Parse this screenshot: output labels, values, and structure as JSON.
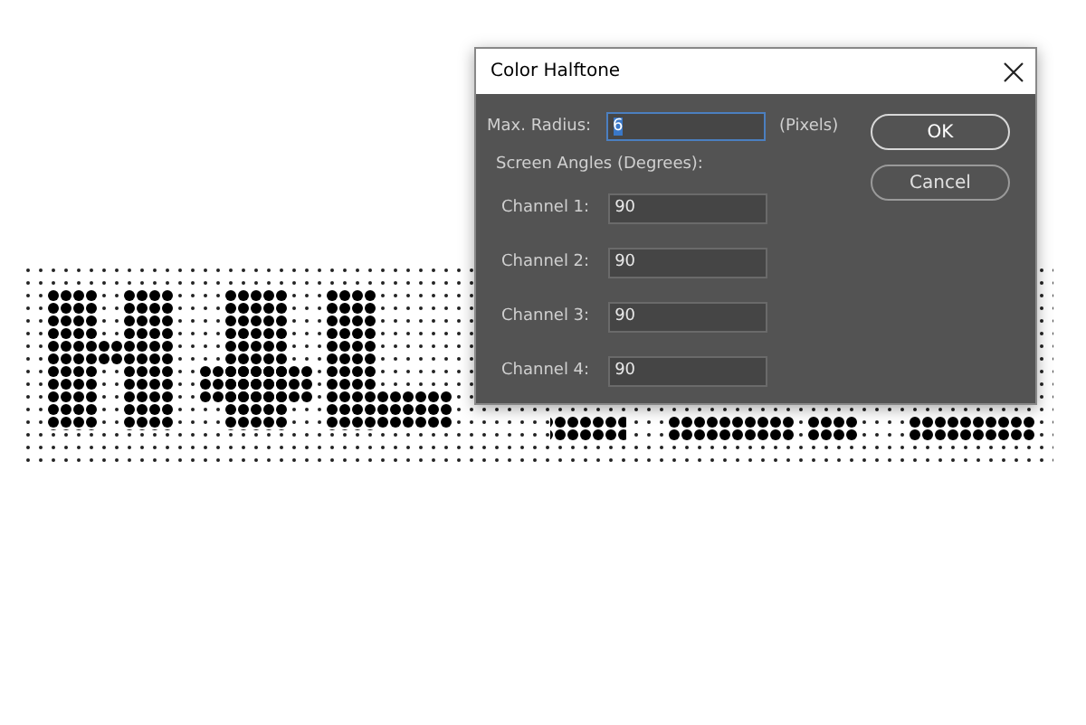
{
  "window": {
    "title": "Color Halftone"
  },
  "max_radius": {
    "label": "Max. Radius:",
    "value": "6",
    "unit": "(Pixels)"
  },
  "screen_angles": {
    "label": "Screen Angles (Degrees):",
    "channels": [
      {
        "label": "Channel 1:",
        "value": "90"
      },
      {
        "label": "Channel 2:",
        "value": "90"
      },
      {
        "label": "Channel 3:",
        "value": "90"
      },
      {
        "label": "Channel 4:",
        "value": "90"
      }
    ]
  },
  "buttons": [
    {
      "label": "OK",
      "default": true
    },
    {
      "label": "Cancel",
      "default": false
    }
  ]
}
